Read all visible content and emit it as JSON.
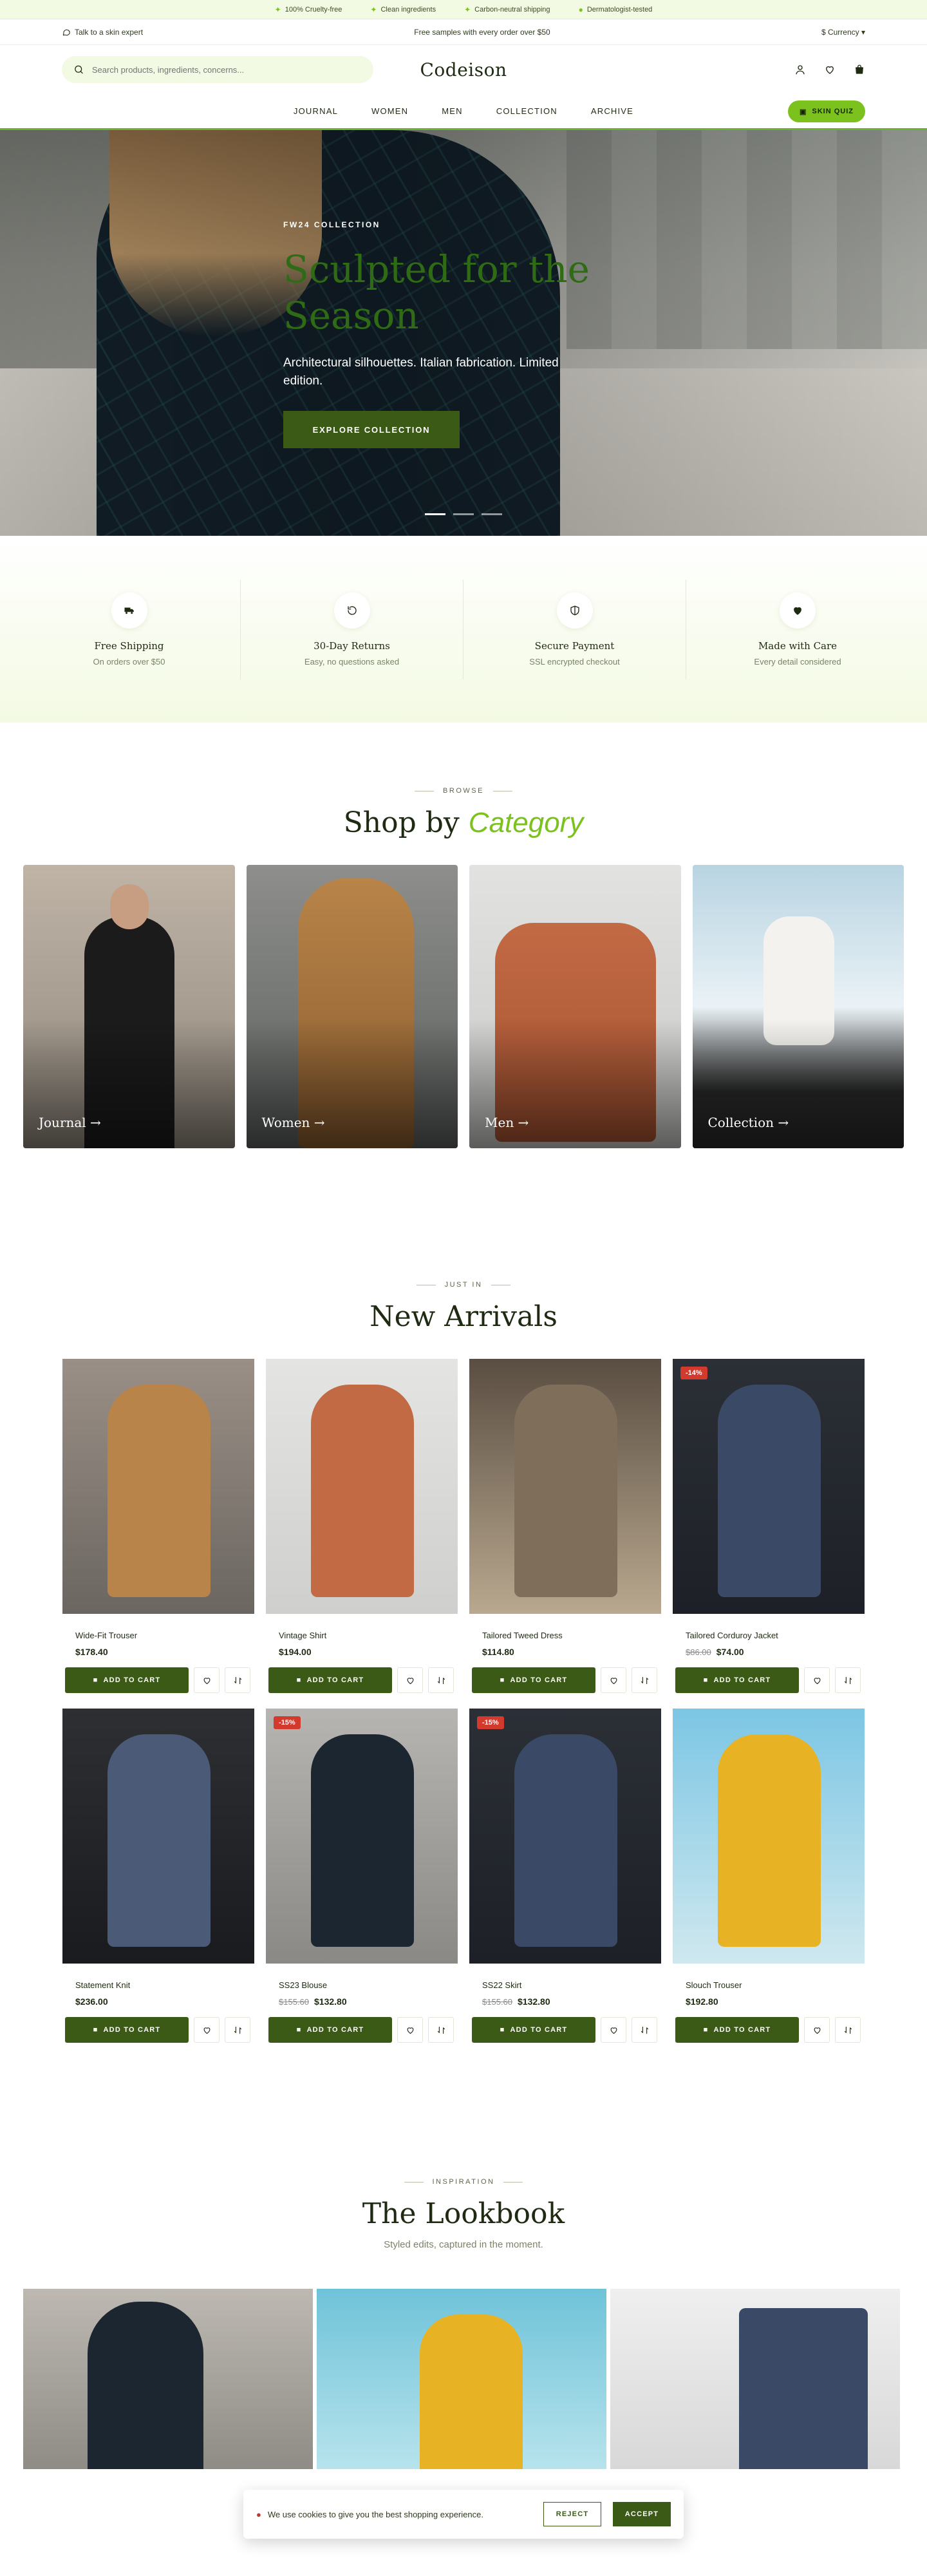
{
  "announce": {
    "items": [
      "100% Cruelty-free",
      "Clean ingredients",
      "Carbon-neutral shipping",
      "Dermatologist-tested"
    ]
  },
  "subbar": {
    "left": "Talk to a skin expert",
    "center": "Free samples with every order over $50",
    "currency": "$ Currency"
  },
  "header": {
    "search_placeholder": "Search products, ingredients, concerns...",
    "logo": "Codeison"
  },
  "nav": {
    "items": [
      "JOURNAL",
      "WOMEN",
      "MEN",
      "COLLECTION",
      "ARCHIVE"
    ],
    "quiz": "SKIN QUIZ"
  },
  "hero": {
    "eyebrow": "FW24 COLLECTION",
    "title": "Sculpted for the Season",
    "subtitle": "Architectural silhouettes. Italian fabrication. Limited edition.",
    "cta": "EXPLORE COLLECTION"
  },
  "features": [
    {
      "title": "Free Shipping",
      "sub": "On orders over $50",
      "icon": "truck-icon"
    },
    {
      "title": "30-Day Returns",
      "sub": "Easy, no questions asked",
      "icon": "return-icon"
    },
    {
      "title": "Secure Payment",
      "sub": "SSL encrypted checkout",
      "icon": "shield-icon"
    },
    {
      "title": "Made with Care",
      "sub": "Every detail considered",
      "icon": "heart-icon"
    }
  ],
  "categories": {
    "eyebrow": "BROWSE",
    "title": "Shop by",
    "title_hl": "Category",
    "items": [
      {
        "label": "Journal →"
      },
      {
        "label": "Women →"
      },
      {
        "label": "Men →"
      },
      {
        "label": "Collection →"
      }
    ]
  },
  "arrivals": {
    "eyebrow": "JUST IN",
    "title": "New Arrivals",
    "add_label": "ADD TO CART",
    "products": [
      {
        "name": "Wide-Fit Trouser",
        "price": "$178.40",
        "old": "",
        "badge": ""
      },
      {
        "name": "Vintage Shirt",
        "price": "$194.00",
        "old": "",
        "badge": ""
      },
      {
        "name": "Tailored Tweed Dress",
        "price": "$114.80",
        "old": "",
        "badge": ""
      },
      {
        "name": "Tailored Corduroy Jacket",
        "price": "$74.00",
        "old": "$86.00",
        "badge": "-14%"
      },
      {
        "name": "Statement Knit",
        "price": "$236.00",
        "old": "",
        "badge": ""
      },
      {
        "name": "SS23 Blouse",
        "price": "$132.80",
        "old": "$155.60",
        "badge": "-15%"
      },
      {
        "name": "SS22 Skirt",
        "price": "$132.80",
        "old": "$155.60",
        "badge": "-15%"
      },
      {
        "name": "Slouch Trouser",
        "price": "$192.80",
        "old": "",
        "badge": ""
      }
    ]
  },
  "lookbook": {
    "eyebrow": "INSPIRATION",
    "title": "The Lookbook",
    "sub": "Styled edits, captured in the moment."
  },
  "cookie": {
    "text": "We use cookies to give you the best shopping experience.",
    "reject": "REJECT",
    "accept": "ACCEPT"
  }
}
